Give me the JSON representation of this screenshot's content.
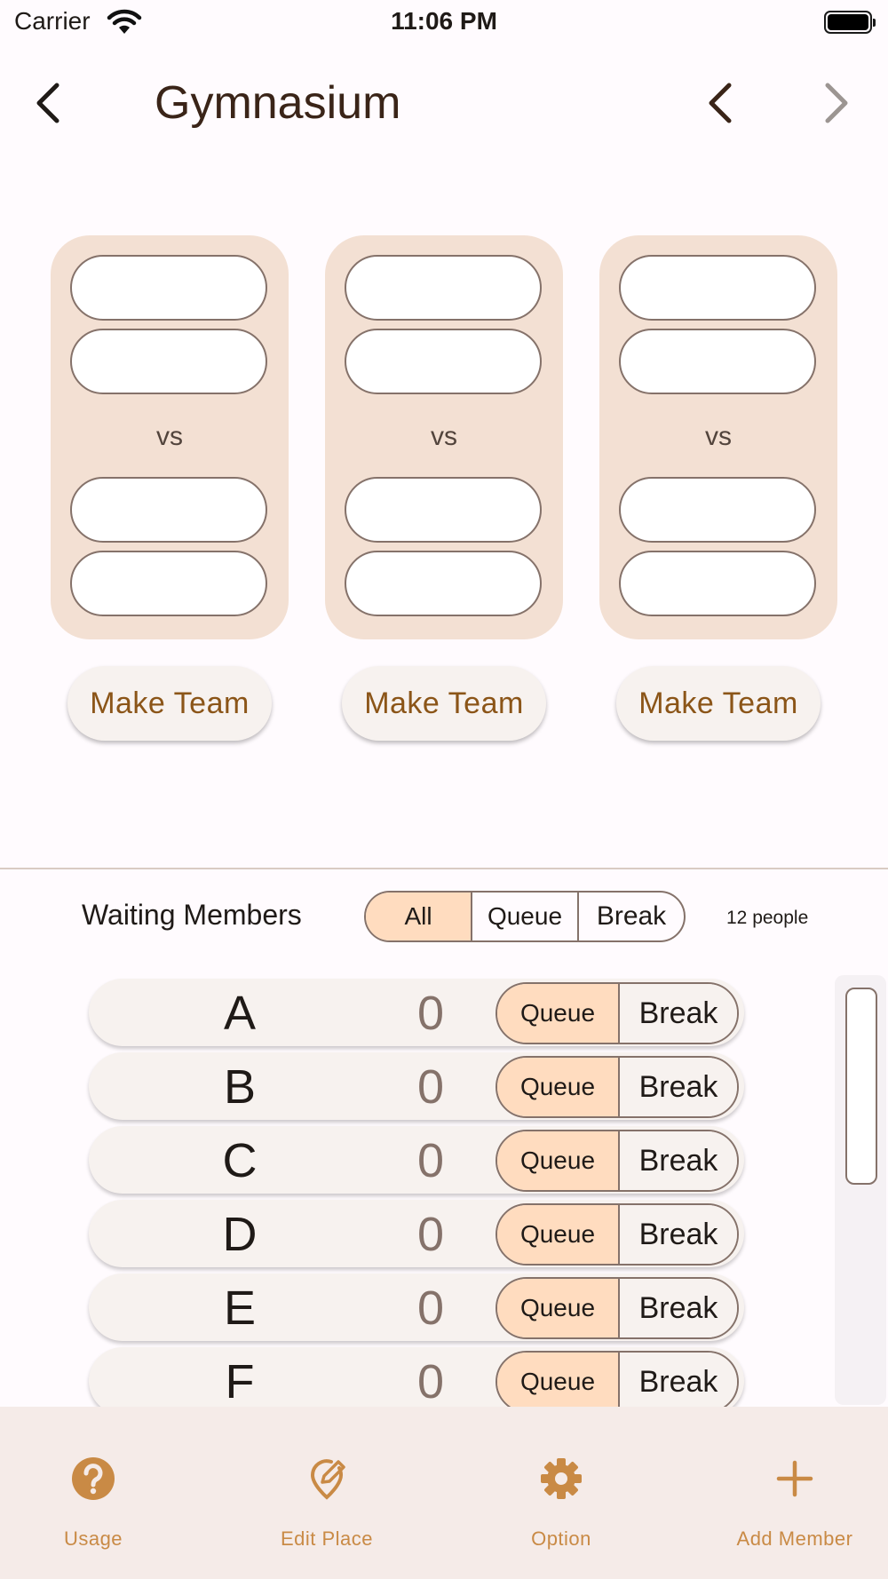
{
  "status_bar": {
    "carrier": "Carrier",
    "time": "11:06 PM"
  },
  "header": {
    "title": "Gymnasium",
    "icons": [
      "back-arrow-icon",
      "chevron-left-icon",
      "chevron-right-icon"
    ]
  },
  "courts": [
    {
      "vs": "vs",
      "make_team": "Make Team"
    },
    {
      "vs": "vs",
      "make_team": "Make Team"
    },
    {
      "vs": "vs",
      "make_team": "Make Team"
    }
  ],
  "waiting": {
    "label": "Waiting Members",
    "filters": [
      "All",
      "Queue",
      "Break"
    ],
    "selected_filter": "All",
    "count": "12 people",
    "members": [
      {
        "name": "A",
        "count": "0",
        "queue": "Queue",
        "break": "Break",
        "status": "Queue"
      },
      {
        "name": "B",
        "count": "0",
        "queue": "Queue",
        "break": "Break",
        "status": "Queue"
      },
      {
        "name": "C",
        "count": "0",
        "queue": "Queue",
        "break": "Break",
        "status": "Queue"
      },
      {
        "name": "D",
        "count": "0",
        "queue": "Queue",
        "break": "Break",
        "status": "Queue"
      },
      {
        "name": "E",
        "count": "0",
        "queue": "Queue",
        "break": "Break",
        "status": "Queue"
      },
      {
        "name": "F",
        "count": "0",
        "queue": "Queue",
        "break": "Break",
        "status": "Queue"
      }
    ]
  },
  "bottom_nav": [
    {
      "label": "Usage",
      "icon": "help-circle-icon"
    },
    {
      "label": "Edit Place",
      "icon": "edit-location-icon"
    },
    {
      "label": "Option",
      "icon": "gear-icon"
    },
    {
      "label": "Add Member",
      "icon": "plus-icon"
    }
  ],
  "colors": {
    "background": "#fffbfe",
    "court": "#f3e0d3",
    "accent": "#c98a45",
    "selected": "#ffdcbf",
    "outline": "#85726a",
    "nav_background": "#f5ebe8"
  }
}
